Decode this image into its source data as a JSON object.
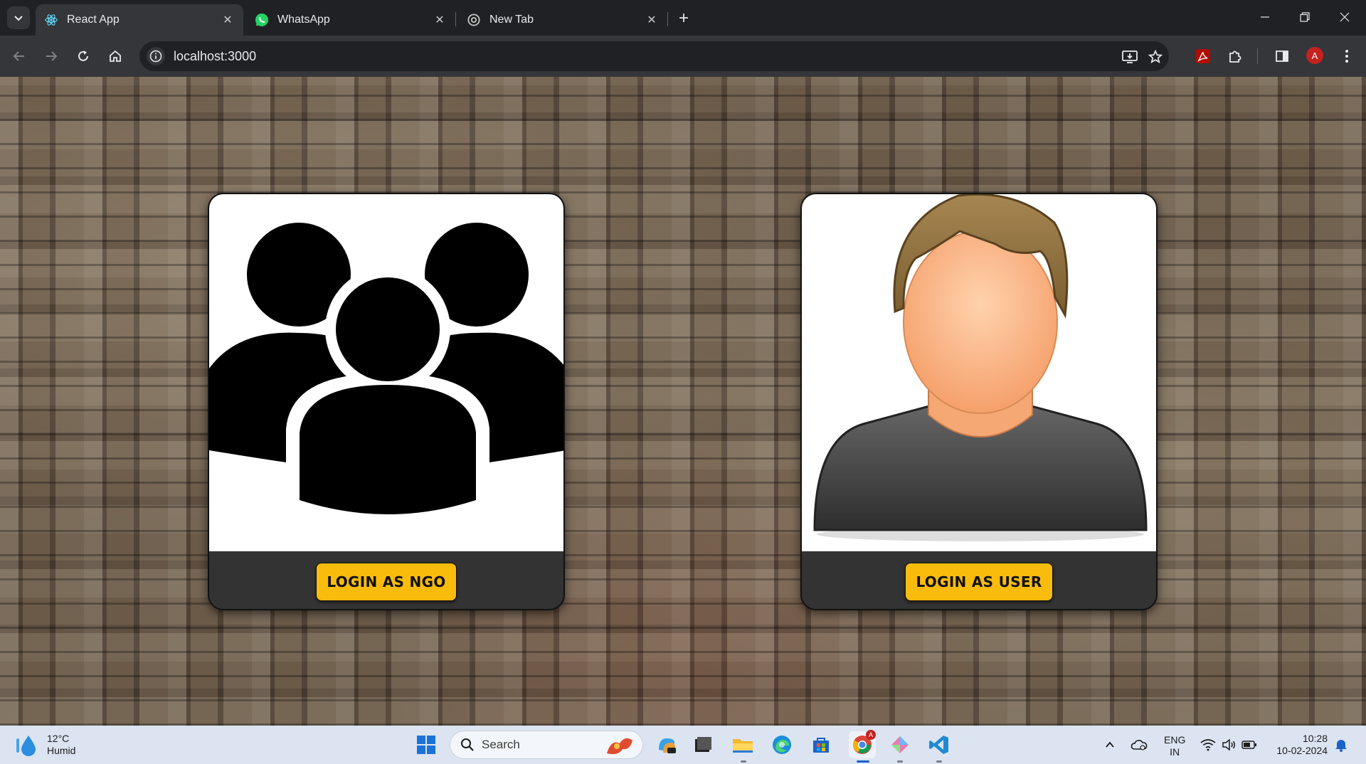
{
  "browser": {
    "tabs": [
      {
        "title": "React App",
        "active": true
      },
      {
        "title": "WhatsApp",
        "active": false
      },
      {
        "title": "New Tab",
        "active": false
      }
    ],
    "url": "localhost:3000",
    "profile_initial": "A"
  },
  "page": {
    "cards": [
      {
        "image": "group-people-icon",
        "button_label": "LOGIN AS NGO"
      },
      {
        "image": "user-avatar-illustration",
        "button_label": "LOGIN AS USER"
      }
    ]
  },
  "taskbar": {
    "weather": {
      "temp": "12°C",
      "condition": "Humid"
    },
    "search_label": "Search",
    "language": {
      "line1": "ENG",
      "line2": "IN"
    },
    "time": "10:28",
    "date": "10-02-2024",
    "chrome_badge": "A"
  },
  "colors": {
    "button": "#f9bc0d",
    "card_footer": "#333333",
    "browser_frame": "#202124",
    "toolbar": "#35363a",
    "taskbar": "#dce4f2"
  }
}
